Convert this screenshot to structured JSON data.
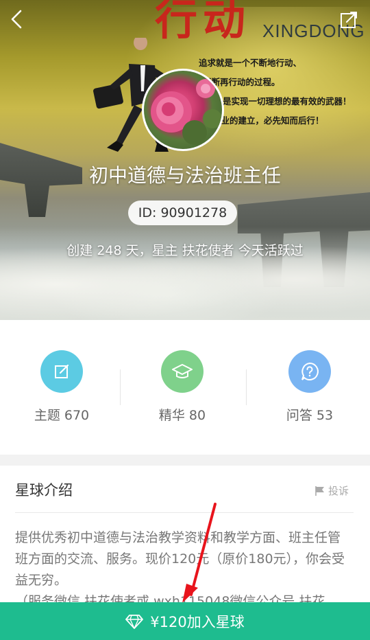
{
  "cover": {
    "headline": "行动",
    "brand": "XINGDONG",
    "slogan": [
      "追求就是一个不断地行动、",
      "不断再行动的过程。",
      "行动是实现一切理想的最有效的武器！",
      "伟业的建立，必先知而后行！"
    ]
  },
  "group": {
    "title": "初中道德与法治班主任",
    "id": "ID: 90901278",
    "meta": "创建 248 天，星主 扶花使者 今天活跃过"
  },
  "stats": [
    {
      "label": "主题 670",
      "icon": "edit-icon",
      "color": "#5ccbe3"
    },
    {
      "label": "精华 80",
      "icon": "graduation-cap-icon",
      "color": "#7fd18b"
    },
    {
      "label": "问答 53",
      "icon": "question-bubble-icon",
      "color": "#79b4f2"
    }
  ],
  "intro": {
    "title": "星球介绍",
    "report_label": "投诉",
    "paragraph1": "提供优秀初中道德与法治教学资料和教学方面、班主任管班方面的交流、服务。现价120元（原价180元），你会受益无穷。",
    "paragraph2": "（服务微信 扶花使者或 wxh115048微信公众号 扶花"
  },
  "join": {
    "label": "¥120加入星球",
    "accent": "#1ebc8f"
  }
}
